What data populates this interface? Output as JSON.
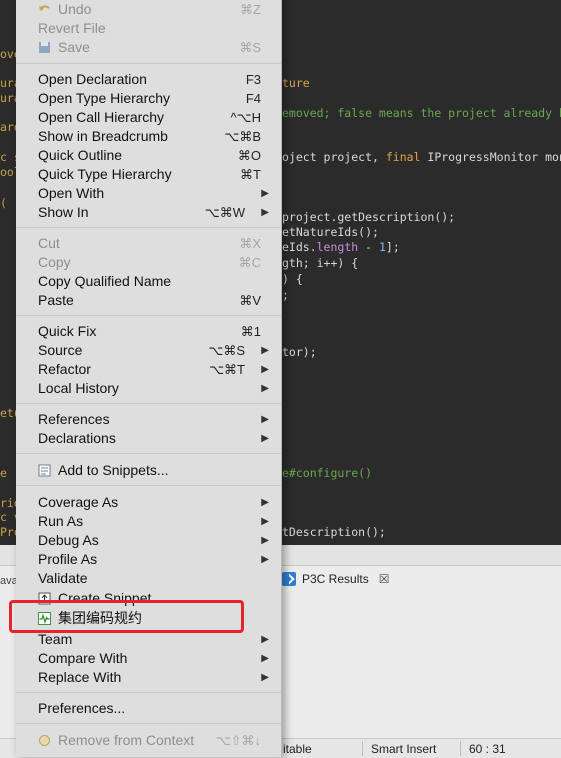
{
  "editor": {
    "lines": [
      {
        "segments": [
          {
            "t": "ture",
            "c": "kw"
          }
        ]
      },
      {
        "segments": [
          {
            "t": "emoved; false means the project already had",
            "c": "cm"
          }
        ]
      },
      {
        "segments": [
          {
            "t": "oject project, ",
            "c": ""
          },
          {
            "t": "final",
            "c": "kw"
          },
          {
            "t": " IProgressMonitor monito",
            "c": ""
          }
        ]
      },
      {
        "segments": [
          {
            "t": "project.getDescription();",
            "c": ""
          }
        ]
      },
      {
        "segments": [
          {
            "t": "etNatureIds();",
            "c": ""
          }
        ]
      },
      {
        "segments": [
          {
            "t": "eIds.",
            "c": ""
          },
          {
            "t": "length",
            "c": "pu"
          },
          {
            "t": " - ",
            "c": ""
          },
          {
            "t": "1",
            "c": "nu"
          },
          {
            "t": "];",
            "c": ""
          }
        ]
      },
      {
        "segments": [
          {
            "t": "gth; i++) {",
            "c": ""
          }
        ]
      },
      {
        "segments": [
          {
            "t": ") {",
            "c": ""
          }
        ]
      },
      {
        "segments": [
          {
            "t": ";",
            "c": ""
          }
        ]
      },
      {
        "segments": [
          {
            "t": "tor);",
            "c": ""
          }
        ]
      },
      {
        "segments": [
          {
            "t": "e#configure()",
            "c": "cm"
          }
        ]
      },
      {
        "segments": [
          {
            "t": "tDescription();",
            "c": ""
          }
        ]
      }
    ],
    "gutter": [
      "ove",
      "ura",
      "ura",
      "aro",
      "c s",
      "ool",
      "(",
      "etu",
      "e",
      "rid",
      "c v",
      "Pro"
    ]
  },
  "bottom_panel": {
    "tab_label": "P3C Results",
    "tab_close": "☒",
    "side_fragment": "ava"
  },
  "status_bar": {
    "writable": "itable",
    "insert_mode": "Smart Insert",
    "cursor_pos": "60 : 31"
  },
  "menu": {
    "undo": {
      "label": "Undo",
      "shortcut": "⌘Z"
    },
    "revert": {
      "label": "Revert File"
    },
    "save": {
      "label": "Save",
      "shortcut": "⌘S"
    },
    "open_declaration": {
      "label": "Open Declaration",
      "shortcut": "F3"
    },
    "open_type_hierarchy": {
      "label": "Open Type Hierarchy",
      "shortcut": "F4"
    },
    "open_call_hierarchy": {
      "label": "Open Call Hierarchy",
      "shortcut": "^⌥H"
    },
    "show_in_breadcrumb": {
      "label": "Show in Breadcrumb",
      "shortcut": "⌥⌘B"
    },
    "quick_outline": {
      "label": "Quick Outline",
      "shortcut": "⌘O"
    },
    "quick_type_hierarchy": {
      "label": "Quick Type Hierarchy",
      "shortcut": "⌘T"
    },
    "open_with": {
      "label": "Open With"
    },
    "show_in": {
      "label": "Show In",
      "shortcut": "⌥⌘W"
    },
    "cut": {
      "label": "Cut",
      "shortcut": "⌘X"
    },
    "copy": {
      "label": "Copy",
      "shortcut": "⌘C"
    },
    "copy_qualified_name": {
      "label": "Copy Qualified Name"
    },
    "paste": {
      "label": "Paste",
      "shortcut": "⌘V"
    },
    "quick_fix": {
      "label": "Quick Fix",
      "shortcut": "⌘1"
    },
    "source": {
      "label": "Source",
      "shortcut": "⌥⌘S"
    },
    "refactor": {
      "label": "Refactor",
      "shortcut": "⌥⌘T"
    },
    "local_history": {
      "label": "Local History"
    },
    "references": {
      "label": "References"
    },
    "declarations": {
      "label": "Declarations"
    },
    "add_to_snippets": {
      "label": "Add to Snippets..."
    },
    "coverage_as": {
      "label": "Coverage As"
    },
    "run_as": {
      "label": "Run As"
    },
    "debug_as": {
      "label": "Debug As"
    },
    "profile_as": {
      "label": "Profile As"
    },
    "validate": {
      "label": "Validate"
    },
    "create_snippet": {
      "label": "Create Snippet..."
    },
    "p3c_check": {
      "label": "集团编码规约"
    },
    "team": {
      "label": "Team"
    },
    "compare_with": {
      "label": "Compare With"
    },
    "replace_with": {
      "label": "Replace With"
    },
    "preferences": {
      "label": "Preferences..."
    },
    "remove_from_context": {
      "label": "Remove from Context",
      "shortcut": "⌥⇧⌘↓"
    }
  }
}
